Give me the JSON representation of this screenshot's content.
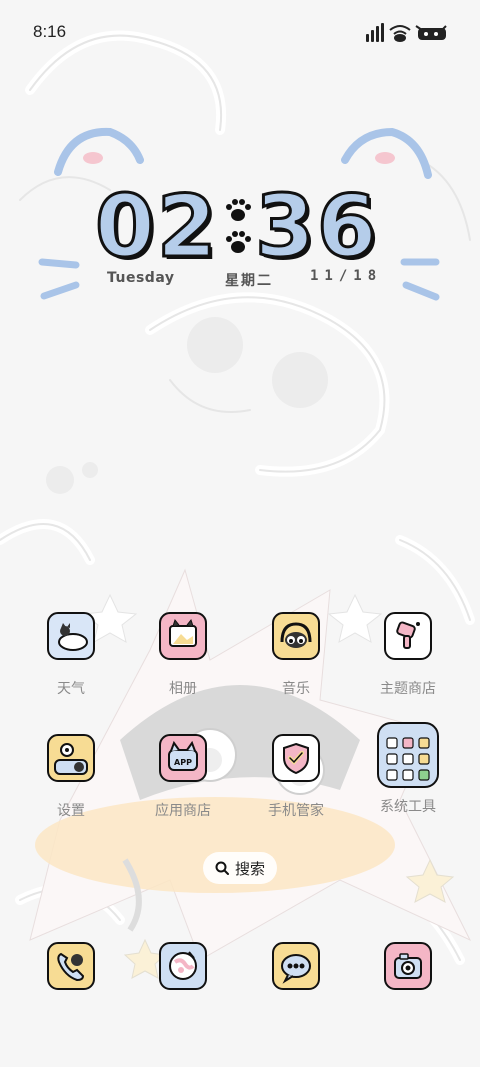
{
  "status_bar": {
    "time": "8:16",
    "icons": [
      "signal-icon",
      "wifi-icon",
      "battery-icon"
    ]
  },
  "clock": {
    "hour": "02",
    "minute": "36",
    "day_en": "Tuesday",
    "day_cn": "星期二",
    "date": "11/18",
    "digit_color": "#b5cdea"
  },
  "apps_row1": [
    {
      "label": "天气",
      "icon": "weather-icon",
      "bg": "#d9e6f7"
    },
    {
      "label": "相册",
      "icon": "gallery-icon",
      "bg": "#f4b6c6"
    },
    {
      "label": "音乐",
      "icon": "music-icon",
      "bg": "#f7dc94"
    },
    {
      "label": "主题商店",
      "icon": "theme-store-icon",
      "bg": "#ffffff"
    }
  ],
  "apps_row2": [
    {
      "label": "设置",
      "icon": "settings-icon",
      "bg": "#f7dc94"
    },
    {
      "label": "应用商店",
      "icon": "app-store-icon",
      "bg": "#f4b6c6"
    },
    {
      "label": "手机管家",
      "icon": "phone-manager-icon",
      "bg": "#ffffff"
    },
    {
      "label": "系统工具",
      "icon": "system-tools-folder-icon",
      "bg": "#cfdff3"
    }
  ],
  "search": {
    "label": "搜索"
  },
  "dock": [
    {
      "icon": "phone-icon",
      "bg": "#f7dc94"
    },
    {
      "icon": "browser-icon",
      "bg": "#cfdff3"
    },
    {
      "icon": "messages-icon",
      "bg": "#f7dc94"
    },
    {
      "icon": "camera-icon",
      "bg": "#f4b6c6"
    }
  ]
}
